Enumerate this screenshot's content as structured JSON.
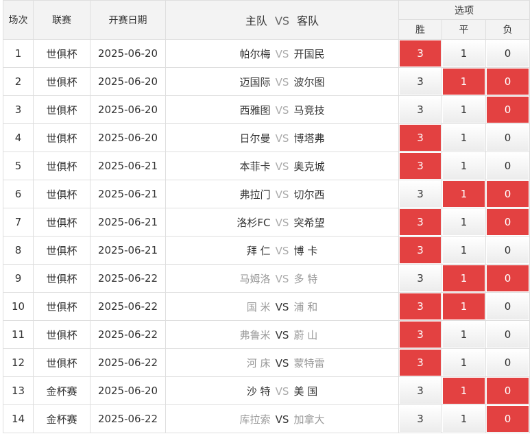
{
  "headers": {
    "index": "场次",
    "league": "联赛",
    "date": "开赛日期",
    "home": "主队",
    "vs": "VS",
    "away": "客队",
    "options": "选项",
    "win": "胜",
    "draw": "平",
    "lose": "负"
  },
  "matches": [
    {
      "idx": "1",
      "league": "世俱杯",
      "date": "2025-06-20",
      "home": "帕尔梅",
      "vs": "VS",
      "away": "开国民",
      "home_gray": false,
      "away_gray": false,
      "vs_dark": false,
      "win": "3",
      "draw": "1",
      "lose": "0",
      "win_sel": true,
      "draw_sel": false,
      "lose_sel": false
    },
    {
      "idx": "2",
      "league": "世俱杯",
      "date": "2025-06-20",
      "home": "迈国际",
      "vs": "VS",
      "away": "波尔图",
      "home_gray": false,
      "away_gray": false,
      "vs_dark": false,
      "win": "3",
      "draw": "1",
      "lose": "0",
      "win_sel": false,
      "draw_sel": true,
      "lose_sel": true
    },
    {
      "idx": "3",
      "league": "世俱杯",
      "date": "2025-06-20",
      "home": "西雅图",
      "vs": "VS",
      "away": "马竞技",
      "home_gray": false,
      "away_gray": false,
      "vs_dark": false,
      "win": "3",
      "draw": "1",
      "lose": "0",
      "win_sel": false,
      "draw_sel": false,
      "lose_sel": true
    },
    {
      "idx": "4",
      "league": "世俱杯",
      "date": "2025-06-20",
      "home": "日尔曼",
      "vs": "VS",
      "away": "博塔弗",
      "home_gray": false,
      "away_gray": false,
      "vs_dark": false,
      "win": "3",
      "draw": "1",
      "lose": "0",
      "win_sel": true,
      "draw_sel": false,
      "lose_sel": false
    },
    {
      "idx": "5",
      "league": "世俱杯",
      "date": "2025-06-21",
      "home": "本菲卡",
      "vs": "VS",
      "away": "奥克城",
      "home_gray": false,
      "away_gray": false,
      "vs_dark": false,
      "win": "3",
      "draw": "1",
      "lose": "0",
      "win_sel": true,
      "draw_sel": false,
      "lose_sel": false
    },
    {
      "idx": "6",
      "league": "世俱杯",
      "date": "2025-06-21",
      "home": "弗拉门",
      "vs": "VS",
      "away": "切尔西",
      "home_gray": false,
      "away_gray": false,
      "vs_dark": false,
      "win": "3",
      "draw": "1",
      "lose": "0",
      "win_sel": false,
      "draw_sel": true,
      "lose_sel": true
    },
    {
      "idx": "7",
      "league": "世俱杯",
      "date": "2025-06-21",
      "home": "洛杉FC",
      "vs": "VS",
      "away": "突希望",
      "home_gray": false,
      "away_gray": false,
      "vs_dark": false,
      "win": "3",
      "draw": "1",
      "lose": "0",
      "win_sel": true,
      "draw_sel": false,
      "lose_sel": true
    },
    {
      "idx": "8",
      "league": "世俱杯",
      "date": "2025-06-21",
      "home": "拜 仁",
      "vs": "VS",
      "away": "博 卡",
      "home_gray": false,
      "away_gray": false,
      "vs_dark": false,
      "win": "3",
      "draw": "1",
      "lose": "0",
      "win_sel": true,
      "draw_sel": false,
      "lose_sel": false
    },
    {
      "idx": "9",
      "league": "世俱杯",
      "date": "2025-06-22",
      "home": "马姆洛",
      "vs": "VS",
      "away": "多 特",
      "home_gray": true,
      "away_gray": true,
      "vs_dark": false,
      "win": "3",
      "draw": "1",
      "lose": "0",
      "win_sel": false,
      "draw_sel": true,
      "lose_sel": true
    },
    {
      "idx": "10",
      "league": "世俱杯",
      "date": "2025-06-22",
      "home": "国 米",
      "vs": "VS",
      "away": "浦 和",
      "home_gray": true,
      "away_gray": true,
      "vs_dark": true,
      "win": "3",
      "draw": "1",
      "lose": "0",
      "win_sel": true,
      "draw_sel": true,
      "lose_sel": false
    },
    {
      "idx": "11",
      "league": "世俱杯",
      "date": "2025-06-22",
      "home": "弗鲁米",
      "vs": "VS",
      "away": "蔚 山",
      "home_gray": true,
      "away_gray": true,
      "vs_dark": true,
      "win": "3",
      "draw": "1",
      "lose": "0",
      "win_sel": true,
      "draw_sel": false,
      "lose_sel": false
    },
    {
      "idx": "12",
      "league": "世俱杯",
      "date": "2025-06-22",
      "home": "河 床",
      "vs": "VS",
      "away": "蒙特雷",
      "home_gray": true,
      "away_gray": true,
      "vs_dark": true,
      "win": "3",
      "draw": "1",
      "lose": "0",
      "win_sel": true,
      "draw_sel": false,
      "lose_sel": false
    },
    {
      "idx": "13",
      "league": "金杯赛",
      "date": "2025-06-20",
      "home": "沙 特",
      "vs": "VS",
      "away": "美 国",
      "home_gray": false,
      "away_gray": false,
      "vs_dark": false,
      "win": "3",
      "draw": "1",
      "lose": "0",
      "win_sel": false,
      "draw_sel": true,
      "lose_sel": true
    },
    {
      "idx": "14",
      "league": "金杯赛",
      "date": "2025-06-22",
      "home": "库拉索",
      "vs": "VS",
      "away": "加拿大",
      "home_gray": true,
      "away_gray": true,
      "vs_dark": true,
      "win": "3",
      "draw": "1",
      "lose": "0",
      "win_sel": false,
      "draw_sel": false,
      "lose_sel": true
    }
  ],
  "colors": {
    "selected": "#e34141",
    "header_bg": "#f3f3f3",
    "border": "#dedede",
    "muted_team": "#999999"
  }
}
